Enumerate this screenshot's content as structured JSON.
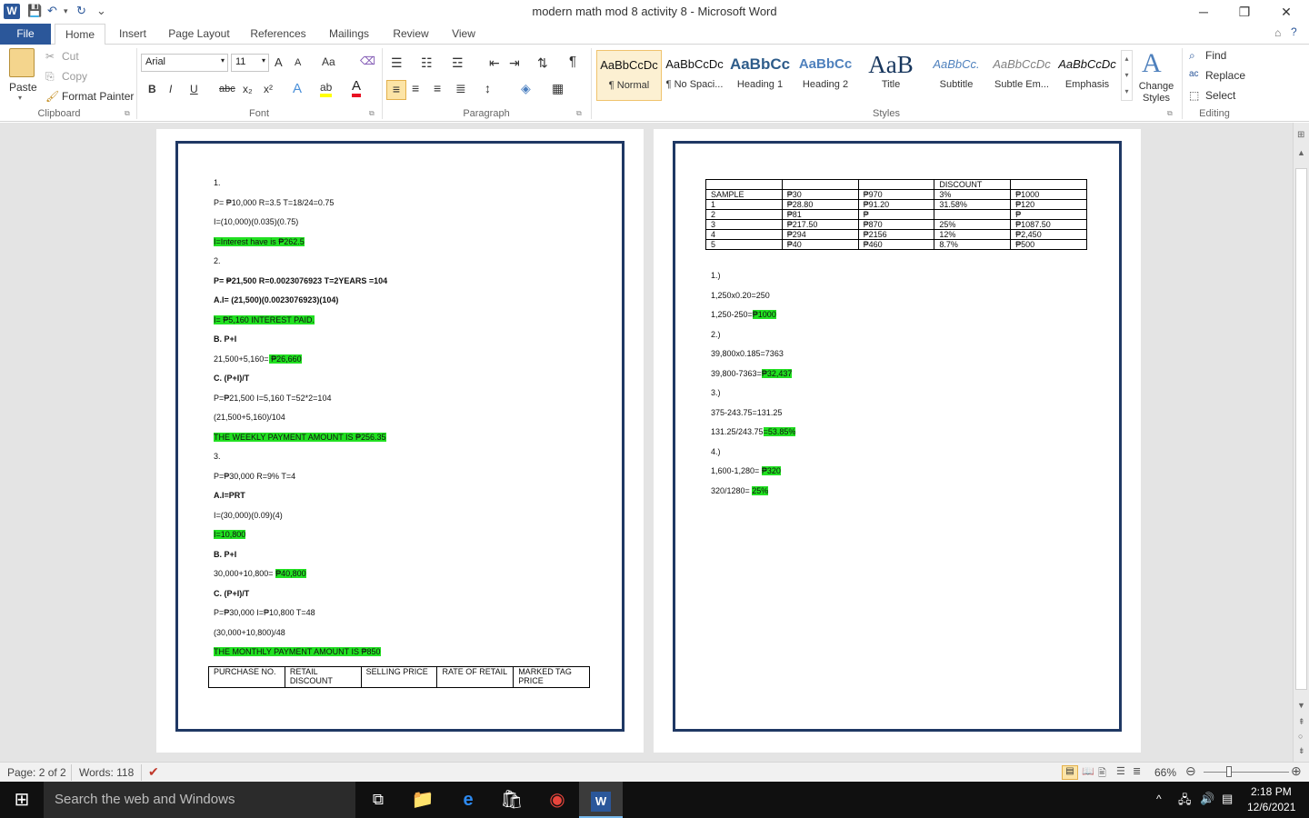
{
  "window": {
    "title": "modern math mod 8 activity 8  -  Microsoft Word",
    "minimize": "─",
    "restore": "❐",
    "close": "✕"
  },
  "tabs": [
    "File",
    "Home",
    "Insert",
    "Page Layout",
    "References",
    "Mailings",
    "Review",
    "View"
  ],
  "clipboard": {
    "paste": "Paste",
    "cut": "Cut",
    "copy": "Copy",
    "format_painter": "Format Painter",
    "label": "Clipboard"
  },
  "font": {
    "name": "Arial",
    "size": "11",
    "label": "Font",
    "grow": "A",
    "shrink": "A",
    "case": "Aa",
    "bold": "B",
    "italic": "I",
    "underline": "U",
    "strike": "abc",
    "sub": "x₂",
    "sup": "x²"
  },
  "paragraph": {
    "label": "Paragraph",
    "pilcrow": "¶"
  },
  "styles": {
    "label": "Styles",
    "items": [
      {
        "sample": "AaBbCcDc",
        "name": "¶ Normal"
      },
      {
        "sample": "AaBbCcDc",
        "name": "¶ No Spaci..."
      },
      {
        "sample": "AaBbCc",
        "name": "Heading 1"
      },
      {
        "sample": "AaBbCc",
        "name": "Heading 2"
      },
      {
        "sample": "AaB",
        "name": "Title"
      },
      {
        "sample": "AaBbCc.",
        "name": "Subtitle"
      },
      {
        "sample": "AaBbCcDc",
        "name": "Subtle Em..."
      },
      {
        "sample": "AaBbCcDc",
        "name": "Emphasis"
      }
    ],
    "change": "Change Styles"
  },
  "editing": {
    "label": "Editing",
    "find": "Find",
    "replace": "Replace",
    "select": "Select"
  },
  "page1": {
    "lines": [
      {
        "t": "1."
      },
      {
        "t": "P= ₱10,000    R=3.5            T=18/24=0.75"
      },
      {
        "t": "I=(10,000)(0.035)(0.75)"
      },
      {
        "t": "I=Interest have is  ₱262.5",
        "hl": true
      },
      {
        "t": "2."
      },
      {
        "t": "P= ₱21,500    R=0.0023076923      T=2YEARS =104",
        "b": true
      },
      {
        "t": "A.I= (21,500)(0.0023076923)(104)",
        "b": true
      },
      {
        "t": "   I= ₱5,160 INTEREST PAID.",
        "hl": true
      },
      {
        "t": "B. P+I",
        "b": true
      },
      {
        "pre": "21,500+5,160=",
        "t": " ₱26,660",
        "hl": true
      },
      {
        "t": "C. (P+I)/T",
        "b": true
      },
      {
        "t": "P=₱21,500    I=5,160                    T=52*2=104"
      },
      {
        "t": "(21,500+5,160)/104"
      },
      {
        "t": "THE WEEKLY PAYMENT AMOUNT IS ₱256.35",
        "hl": true
      },
      {
        "t": "3."
      },
      {
        "t": "P=₱30,000    R=9%            T=4"
      },
      {
        "t": "A.I=PRT",
        "b": true
      },
      {
        "t": "I=(30,000)(0.09)(4)"
      },
      {
        "t": "I=10,800",
        "hl": true
      },
      {
        "t": "B. P+I",
        "b": true
      },
      {
        "pre": "30,000+10,800= ",
        "t": "₱40,800",
        "hl": true
      },
      {
        "t": "C. (P+I)/T",
        "b": true
      },
      {
        "t": "P=₱30,000    I=₱10,800      T=48"
      },
      {
        "t": "(30,000+10,800)/48"
      },
      {
        "t": "THE MONTHLY PAYMENT AMOUNT IS ₱850",
        "hl": true
      }
    ],
    "table_headers": [
      "PURCHASE NO.",
      "RETAIL DISCOUNT",
      "SELLING PRICE",
      "RATE OF RETAIL",
      "MARKED TAG PRICE"
    ]
  },
  "page2": {
    "table_rows": [
      [
        "",
        "",
        "",
        "DISCOUNT",
        ""
      ],
      [
        "SAMPLE",
        "₱30",
        "₱970",
        "3%",
        "₱1000"
      ],
      [
        "1",
        "₱28.80",
        "₱91.20",
        "31.58%",
        "₱120"
      ],
      [
        "2",
        "₱81",
        "₱",
        "",
        "₱"
      ],
      [
        "3",
        "₱217.50",
        "₱870",
        "25%",
        "₱1087.50"
      ],
      [
        "4",
        "₱294",
        "₱2156",
        "12%",
        "₱2,450"
      ],
      [
        "5",
        "₱40",
        "₱460",
        "8.7%",
        "₱500"
      ]
    ],
    "lines": [
      {
        "t": "1.)"
      },
      {
        "t": "1,250x0.20=250"
      },
      {
        "pre": "1,250-250=",
        "t": "₱1000",
        "hl": true
      },
      {
        "t": "2.)"
      },
      {
        "t": "39,800x0.185=7363"
      },
      {
        "pre": "39,800-7363=",
        "t": "₱32,437",
        "hl": true
      },
      {
        "t": "3.)"
      },
      {
        "t": "375-243.75=131.25"
      },
      {
        "pre": "131.25/243.75",
        "t": "=53.85%",
        "hl": true
      },
      {
        "t": "4.)"
      },
      {
        "pre": "1,600-1,280= ",
        "t": "₱320",
        "hl": true
      },
      {
        "pre": "320/1280= ",
        "t": "25%",
        "hl": true
      }
    ]
  },
  "status": {
    "page": "Page: 2 of 2",
    "words": "Words: 118",
    "zoom": "66%"
  },
  "taskbar": {
    "search": "Search the web and Windows",
    "time": "2:18 PM",
    "date": "12/6/2021"
  }
}
